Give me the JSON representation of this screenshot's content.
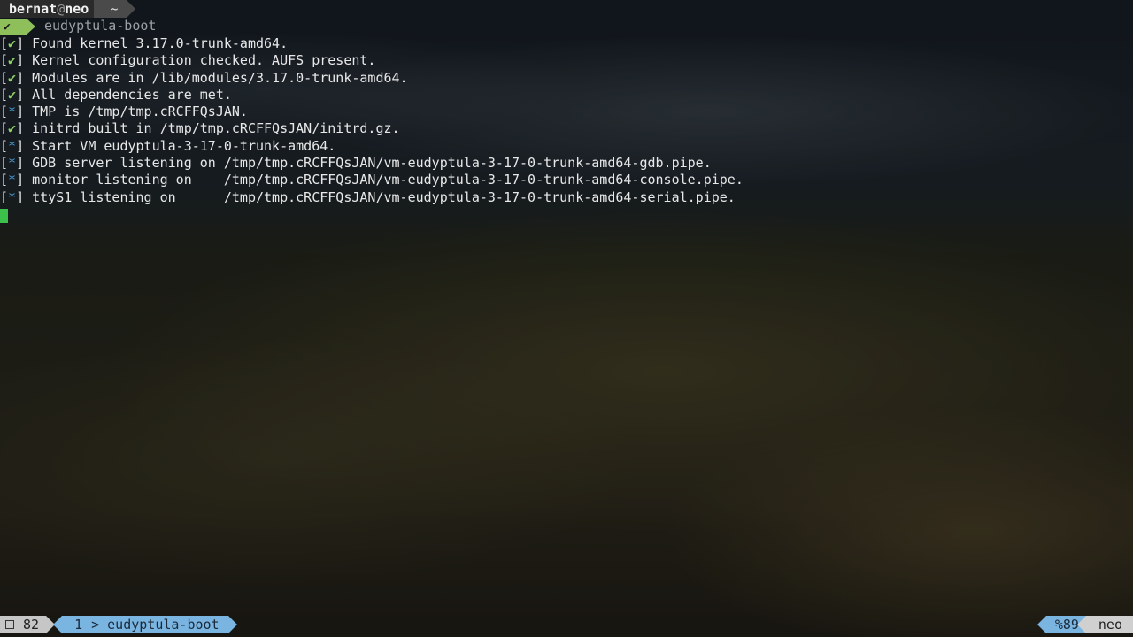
{
  "prompt": {
    "user": "bernat",
    "at": "@",
    "host": "neo",
    "dir": "~",
    "ok_glyph": "✔",
    "command": "eudyptula-boot"
  },
  "output": [
    {
      "mark": "✔",
      "kind": "ok",
      "text": "Found kernel 3.17.0-trunk-amd64."
    },
    {
      "mark": "✔",
      "kind": "ok",
      "text": "Kernel configuration checked. AUFS present."
    },
    {
      "mark": "✔",
      "kind": "ok",
      "text": "Modules are in /lib/modules/3.17.0-trunk-amd64."
    },
    {
      "mark": "✔",
      "kind": "ok",
      "text": "All dependencies are met."
    },
    {
      "mark": "*",
      "kind": "info",
      "text": "TMP is /tmp/tmp.cRCFFQsJAN."
    },
    {
      "mark": "✔",
      "kind": "ok",
      "text": "initrd built in /tmp/tmp.cRCFFQsJAN/initrd.gz."
    },
    {
      "mark": "*",
      "kind": "info",
      "text": "Start VM eudyptula-3-17-0-trunk-amd64."
    },
    {
      "mark": "*",
      "kind": "info",
      "text": "GDB server listening on /tmp/tmp.cRCFFQsJAN/vm-eudyptula-3-17-0-trunk-amd64-gdb.pipe."
    },
    {
      "mark": "*",
      "kind": "info",
      "text": "monitor listening on    /tmp/tmp.cRCFFQsJAN/vm-eudyptula-3-17-0-trunk-amd64-console.pipe."
    },
    {
      "mark": "*",
      "kind": "info",
      "text": "ttyS1 listening on      /tmp/tmp.cRCFFQsJAN/vm-eudyptula-3-17-0-trunk-amd64-serial.pipe."
    }
  ],
  "statusbar": {
    "pane_count": "82",
    "window_index": "1",
    "window_name": "> eudyptula-boot",
    "battery": "%89",
    "hostname": "neo"
  },
  "colors": {
    "ok": "#8fd16a",
    "info": "#4aa3df",
    "cursor": "#3cc24a",
    "status_accent": "#7ab4e0"
  }
}
